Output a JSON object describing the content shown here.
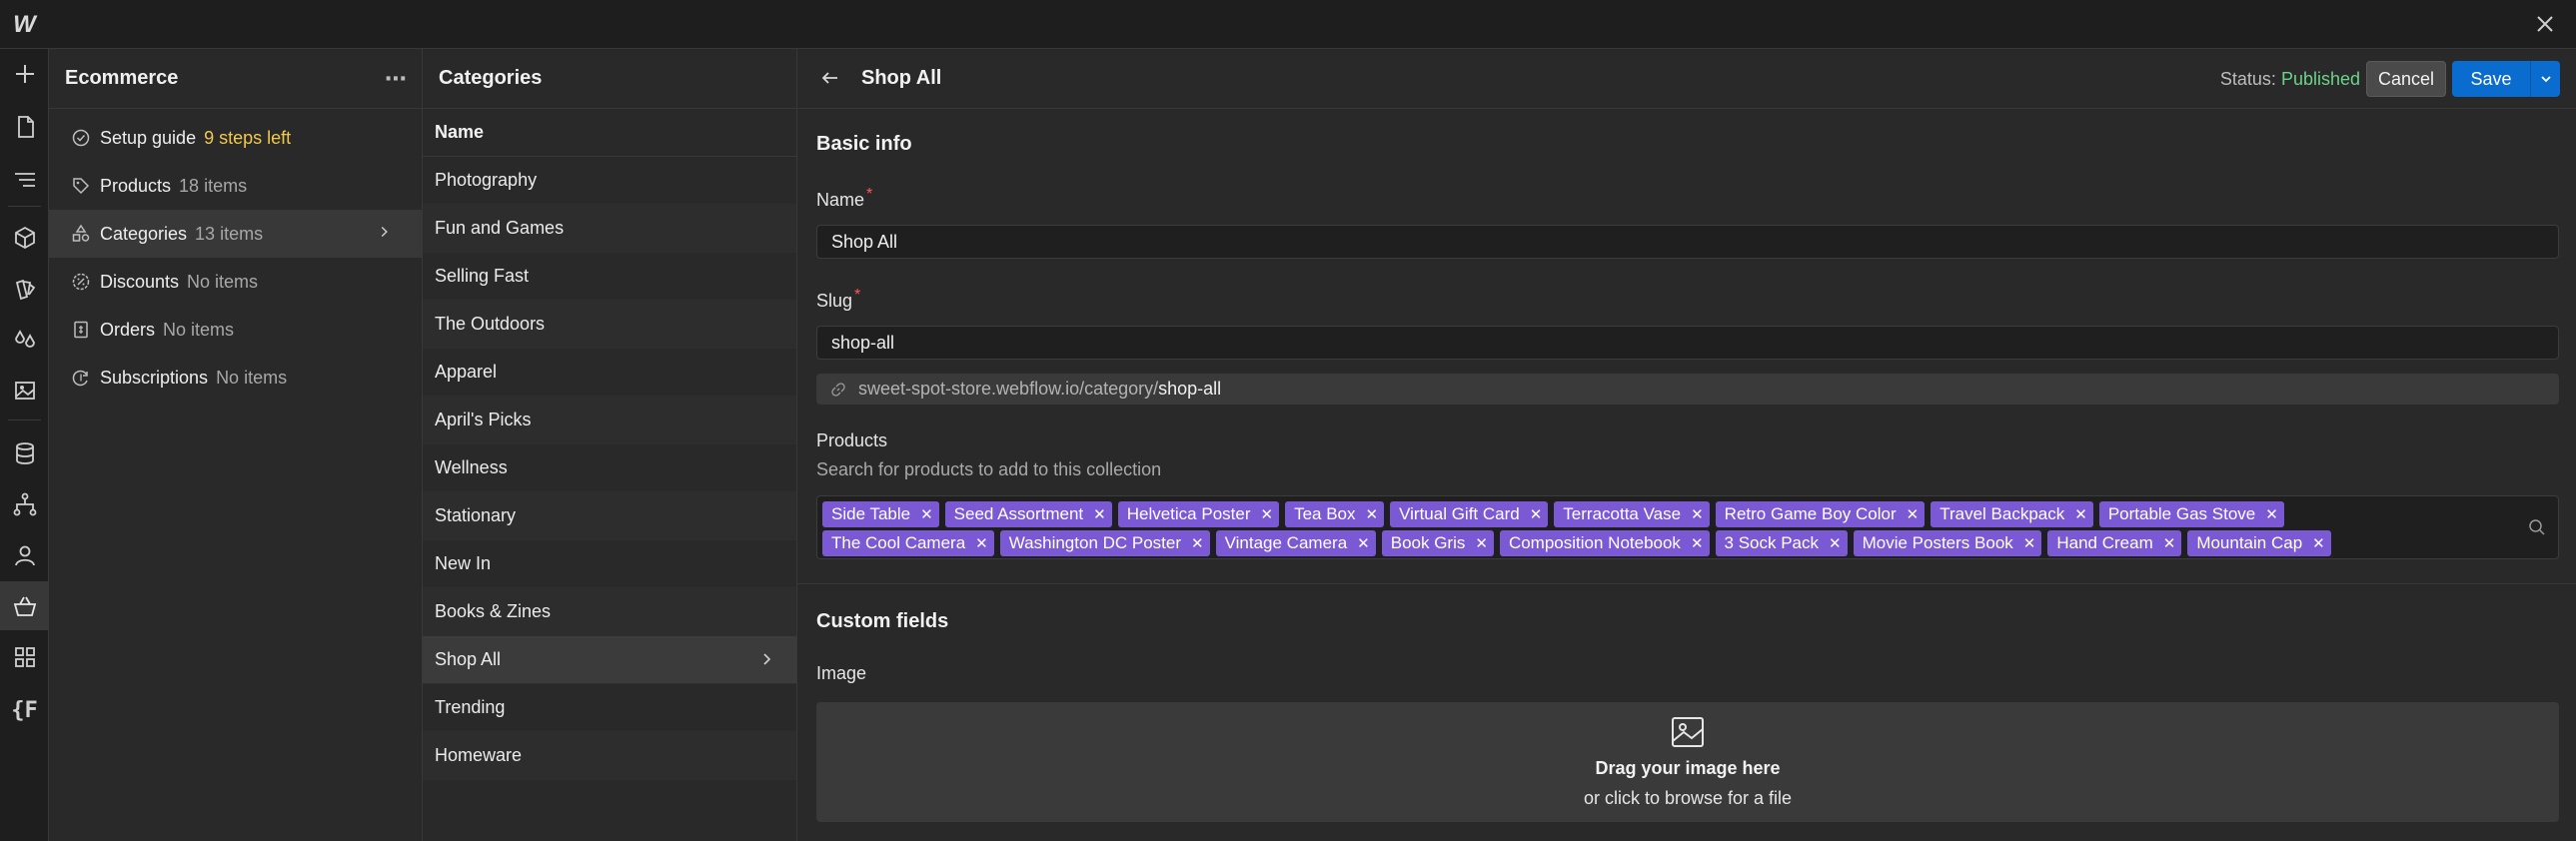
{
  "app": {
    "logo": "W"
  },
  "rail": {
    "icons": [
      "plus-icon",
      "page-icon",
      "navigator-icon",
      "components-icon",
      "styles-icon",
      "variables-icon",
      "assets-icon",
      "cms-icon",
      "logic-icon",
      "users-icon",
      "ecommerce-icon",
      "apps-icon",
      "code-icon"
    ],
    "code_label": "{F"
  },
  "ecommerce": {
    "title": "Ecommerce",
    "items": [
      {
        "label": "Setup guide",
        "count": "9 steps left",
        "icon": "check-circle-icon"
      },
      {
        "label": "Products",
        "count": "18 items",
        "icon": "tag-icon"
      },
      {
        "label": "Categories",
        "count": "13 items",
        "icon": "shapes-icon"
      },
      {
        "label": "Discounts",
        "count": "No items",
        "icon": "discount-icon"
      },
      {
        "label": "Orders",
        "count": "No items",
        "icon": "receipt-icon"
      },
      {
        "label": "Subscriptions",
        "count": "No items",
        "icon": "subscription-icon"
      }
    ]
  },
  "categories": {
    "title": "Categories",
    "column_header": "Name",
    "rows": [
      "Photography",
      "Fun and Games",
      "Selling Fast",
      "The Outdoors",
      "Apparel",
      "April's Picks",
      "Wellness",
      "Stationary",
      "New In",
      "Books & Zines",
      "Shop All",
      "Trending",
      "Homeware"
    ],
    "selected": "Shop All"
  },
  "editor": {
    "title": "Shop All",
    "status_label": "Status:",
    "status_value": "Published",
    "cancel_label": "Cancel",
    "save_label": "Save",
    "basic_info": "Basic info",
    "name_label": "Name",
    "name_value": "Shop All",
    "slug_label": "Slug",
    "slug_value": "shop-all",
    "url_prefix": "sweet-spot-store.webflow.io/category/",
    "url_slug": "shop-all",
    "products_label": "Products",
    "products_help": "Search for products to add to this collection",
    "products_row1": [
      "Side Table",
      "Seed Assortment",
      "Helvetica Poster",
      "Tea Box",
      "Virtual Gift Card",
      "Terracotta Vase",
      "Retro Game Boy Color",
      "Travel Backpack",
      "Portable Gas Stove"
    ],
    "products_row2": [
      "The Cool Camera",
      "Washington DC Poster",
      "Vintage Camera",
      "Book Gris",
      "Composition Notebook",
      "3 Sock Pack",
      "Movie Posters Book",
      "Hand Cream",
      "Mountain Cap"
    ],
    "custom_fields": "Custom fields",
    "image_label": "Image",
    "drop_title": "Drag your image here",
    "drop_sub": "or click to browse for a file"
  },
  "colors": {
    "accent": "#0a6ccf",
    "tag": "#7b59d4",
    "published": "#6bd38a",
    "warning": "#f2c94c"
  }
}
